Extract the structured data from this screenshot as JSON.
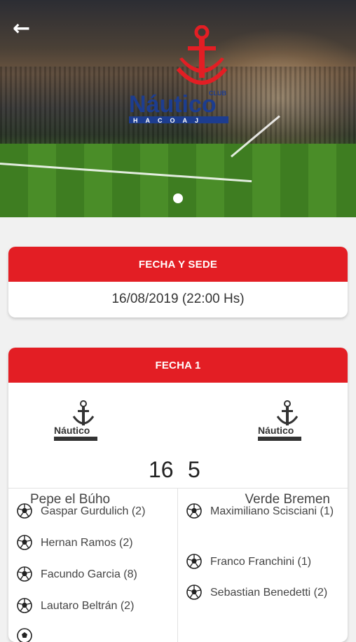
{
  "header": {
    "back_icon": "arrow-left-icon",
    "logo_text_club": "CLUB",
    "logo_text_name": "Náutico",
    "logo_text_sub": "HACOAJ",
    "carousel_index": 1,
    "carousel_total": 1
  },
  "fecha_sede": {
    "title": "FECHA Y SEDE",
    "value": "16/08/2019 (22:00 Hs)"
  },
  "match": {
    "title": "FECHA 1",
    "home": {
      "name": "Pepe el Búho",
      "score": "16"
    },
    "away": {
      "name": "Verde Bremen",
      "score": "5"
    },
    "home_scorers": [
      "Gaspar Gurdulich (2)",
      "Hernan Ramos (2)",
      "Facundo Garcia (8)",
      "Lautaro Beltrán (2)"
    ],
    "away_scorers": [
      "Maximiliano Scisciani (1)",
      "Franco Franchini (1)",
      "Sebastian Benedetti (2)"
    ]
  },
  "colors": {
    "accent": "#e31e24",
    "logo_blue": "#1d3d8f",
    "background": "#f1f1f1"
  }
}
